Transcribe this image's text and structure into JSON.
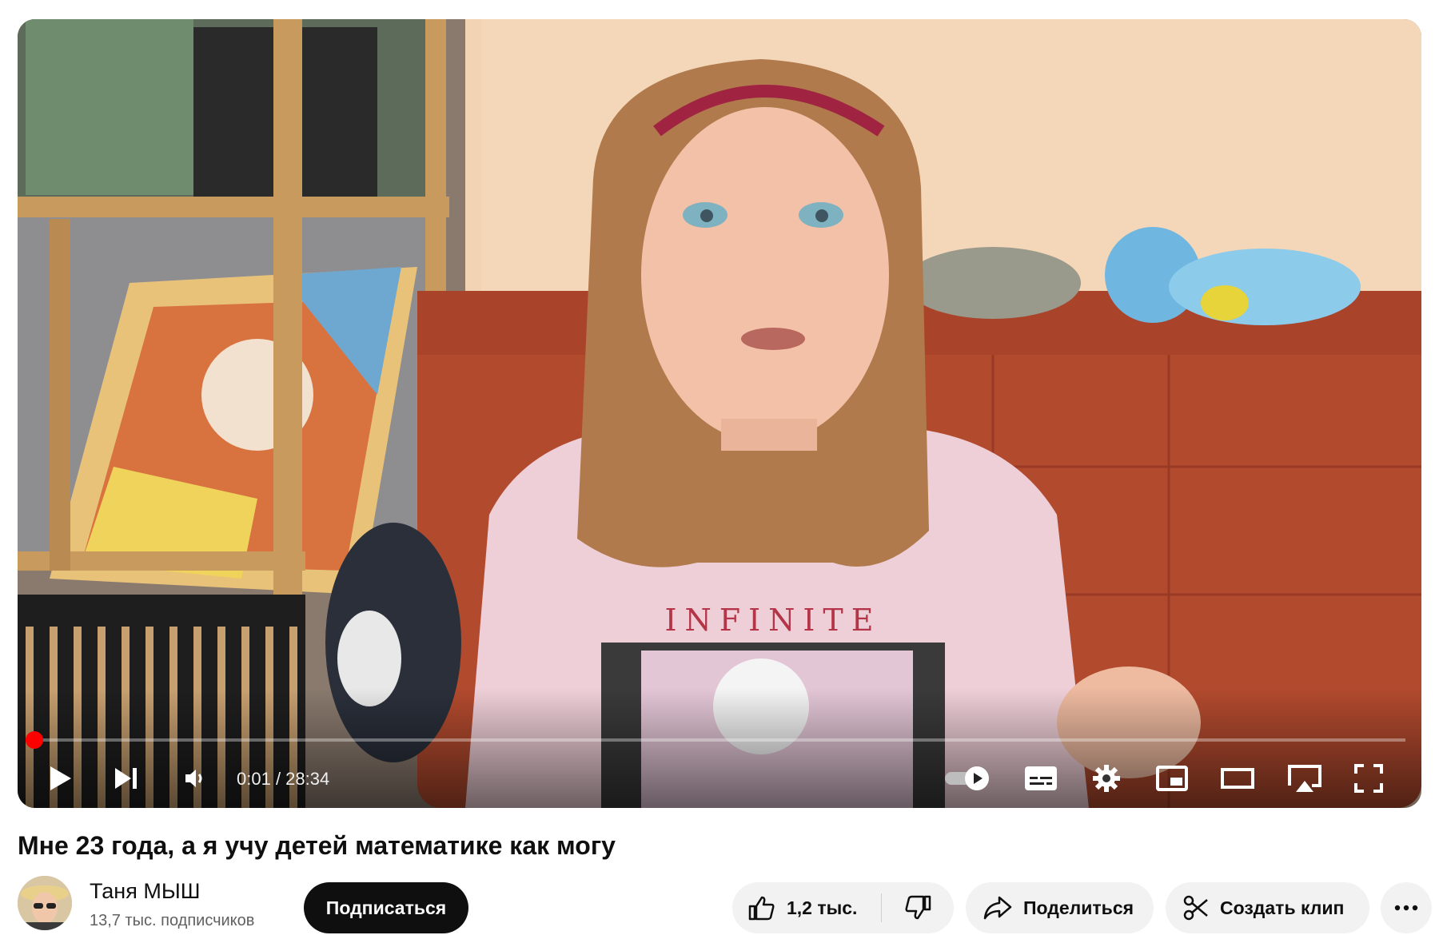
{
  "player": {
    "time_current": "0:01",
    "time_separator": " / ",
    "time_total": "28:34",
    "progress_fraction": 0.0006,
    "accent_color": "#ff0000",
    "shirt_text": "INFINITE",
    "controls": [
      "play-icon",
      "next-icon",
      "volume-icon",
      "autoplay-toggle-icon",
      "subtitles-icon",
      "settings-gear-icon",
      "miniplayer-icon",
      "theater-mode-icon",
      "cast-icon",
      "fullscreen-icon"
    ]
  },
  "video": {
    "title": "Мне 23 года, а я учу детей математике как могу"
  },
  "owner": {
    "channel_name": "Таня МЫШ",
    "subscribers": "13,7 тыс. подписчиков",
    "subscribe_label": "Подписаться"
  },
  "actions": {
    "likes": "1,2 тыс.",
    "share_label": "Поделиться",
    "clip_label": "Создать клип",
    "more_icon": "more-horizontal-icon"
  }
}
